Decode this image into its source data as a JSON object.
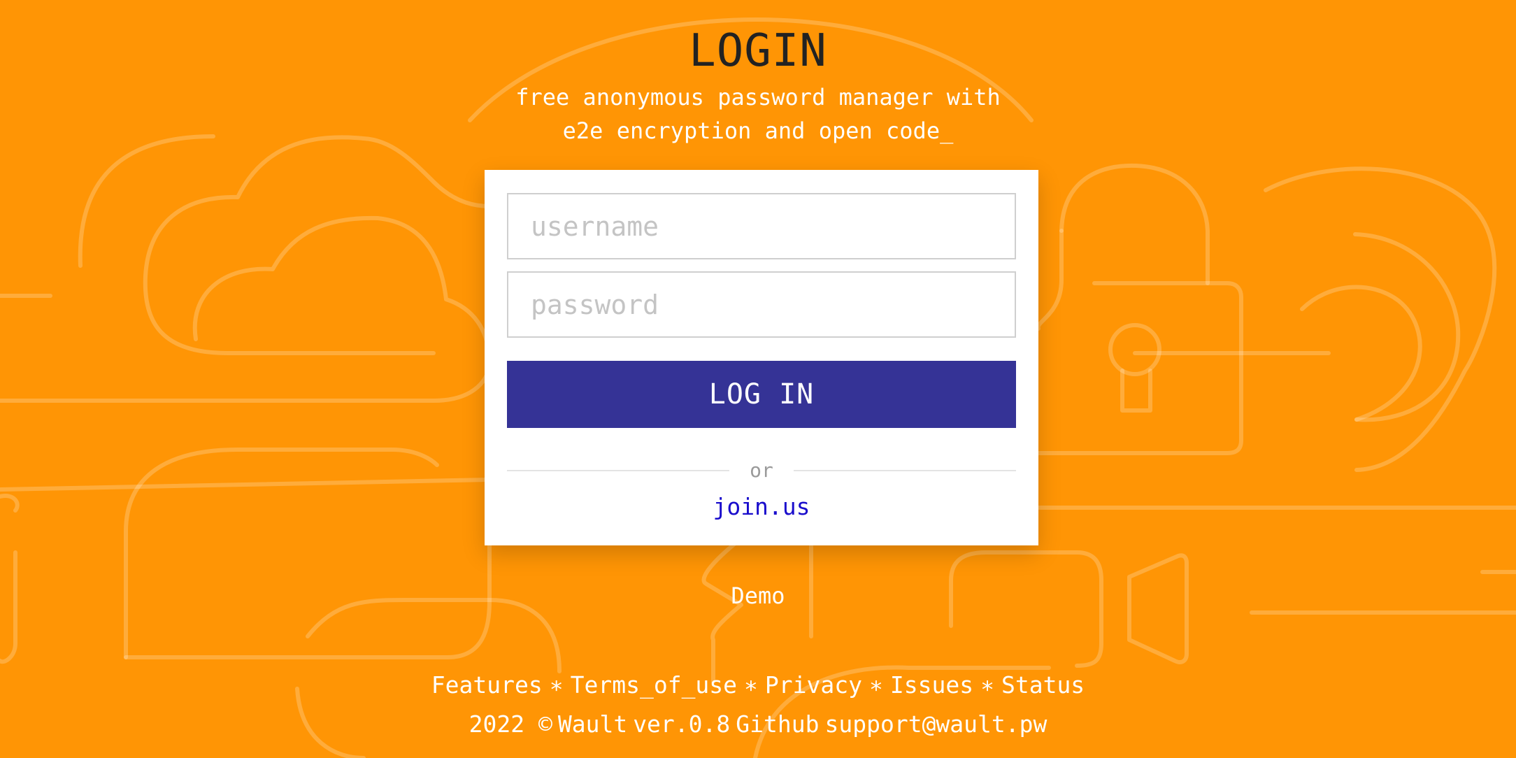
{
  "header": {
    "title": "LOGIN",
    "subtitle_line1": "free anonymous password manager with",
    "subtitle_line2": "e2e encryption and open code_"
  },
  "form": {
    "username_placeholder": "username",
    "password_placeholder": "password",
    "login_button": "LOG IN",
    "or_text": "or",
    "join_link": "join.us"
  },
  "demo_link": "Demo",
  "footer": {
    "links": [
      "Features",
      "Terms_of_use",
      "Privacy",
      "Issues",
      "Status"
    ],
    "separator": "∗",
    "year_copyright": "2022 ©",
    "brand": "Wault",
    "version": "ver.0.8",
    "github": "Github",
    "support_email": "support@wault.pw"
  },
  "colors": {
    "background": "#FF9505",
    "button": "#353396",
    "link": "#1a0dcc",
    "title": "#222222"
  },
  "icons": [
    "cloud-icon",
    "padlock-icon",
    "video-camera-icon",
    "password-swirl-icon"
  ]
}
